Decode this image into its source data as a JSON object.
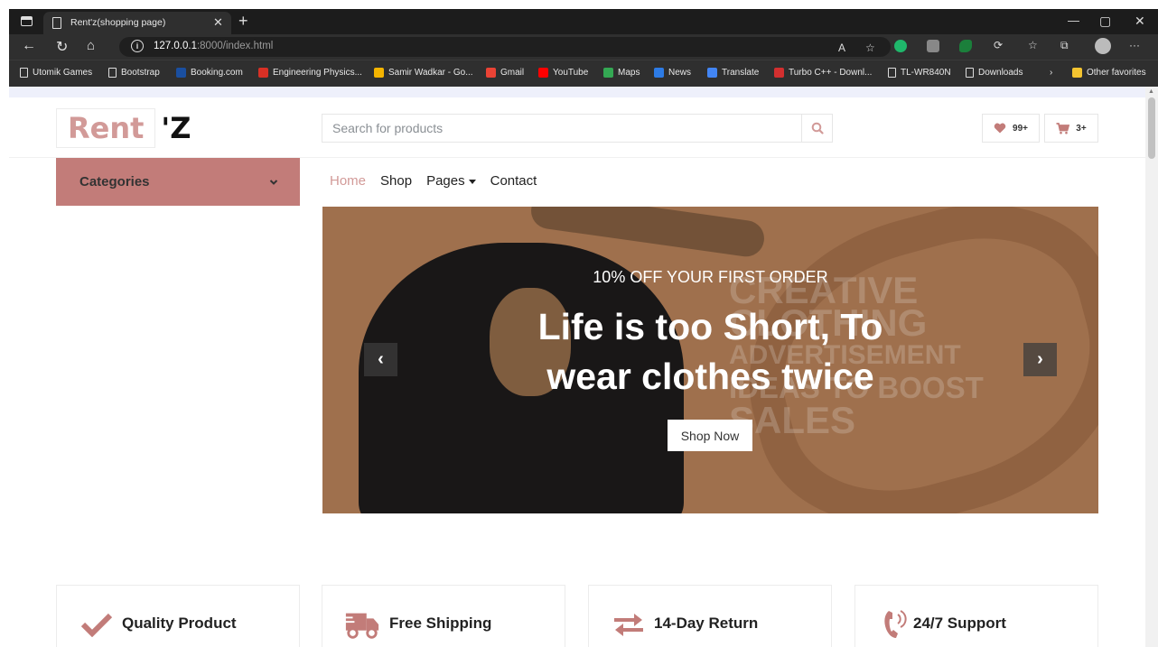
{
  "browser": {
    "tab_title": "Rent'z(shopping page)",
    "url_host": "127.0.0.1",
    "url_rest": ":8000/index.html",
    "bookmarks": [
      {
        "label": "Utomik Games",
        "icon": "page-icon",
        "color": "#dddddd"
      },
      {
        "label": "Bootstrap",
        "icon": "page-icon",
        "color": "#dddddd"
      },
      {
        "label": "Booking.com",
        "icon": "booking-icon",
        "color": "#1a4fa0"
      },
      {
        "label": "Engineering Physics...",
        "icon": "pdf-icon",
        "color": "#d93025"
      },
      {
        "label": "Samir Wadkar - Go...",
        "icon": "drive-icon",
        "color": "#f4b400"
      },
      {
        "label": "Gmail",
        "icon": "gmail-icon",
        "color": "#ea4335"
      },
      {
        "label": "YouTube",
        "icon": "youtube-icon",
        "color": "#ff0000"
      },
      {
        "label": "Maps",
        "icon": "maps-icon",
        "color": "#34a853"
      },
      {
        "label": "News",
        "icon": "news-icon",
        "color": "#2d7be5"
      },
      {
        "label": "Translate",
        "icon": "translate-icon",
        "color": "#4285f4"
      },
      {
        "label": "Turbo C++ - Downl...",
        "icon": "turbo-icon",
        "color": "#d32f2f"
      },
      {
        "label": "TL-WR840N",
        "icon": "page-icon",
        "color": "#dddddd"
      },
      {
        "label": "Downloads",
        "icon": "page-icon",
        "color": "#dddddd"
      }
    ],
    "other_favorites": "Other favorites"
  },
  "site": {
    "logo_main": "Rent",
    "logo_suffix": "'Z",
    "search_placeholder": "Search for products",
    "wishlist_count": "99+",
    "cart_count": "3+",
    "categories_label": "Categories",
    "nav": [
      {
        "label": "Home",
        "active": true
      },
      {
        "label": "Shop"
      },
      {
        "label": "Pages"
      },
      {
        "label": "Contact"
      }
    ],
    "hero": {
      "subtitle": "10% OFF YOUR FIRST ORDER",
      "headline_line1": "Life is too Short, To",
      "headline_line2": "wear clothes twice",
      "button": "Shop Now",
      "watermark_lines": [
        "CREATIVE",
        "CLOTHING",
        "ADVERTISEMENT",
        "IDEAS TO BOOST",
        "SALES"
      ]
    },
    "features": [
      {
        "label": "Quality Product",
        "icon": "check-icon"
      },
      {
        "label": "Free Shipping",
        "icon": "shipping-truck-icon"
      },
      {
        "label": "14-Day Return",
        "icon": "exchange-arrows-icon"
      },
      {
        "label": "24/7 Support",
        "icon": "phone-volume-icon"
      }
    ],
    "accent_color": "#d29a98",
    "category_bg": "#c27c79"
  }
}
